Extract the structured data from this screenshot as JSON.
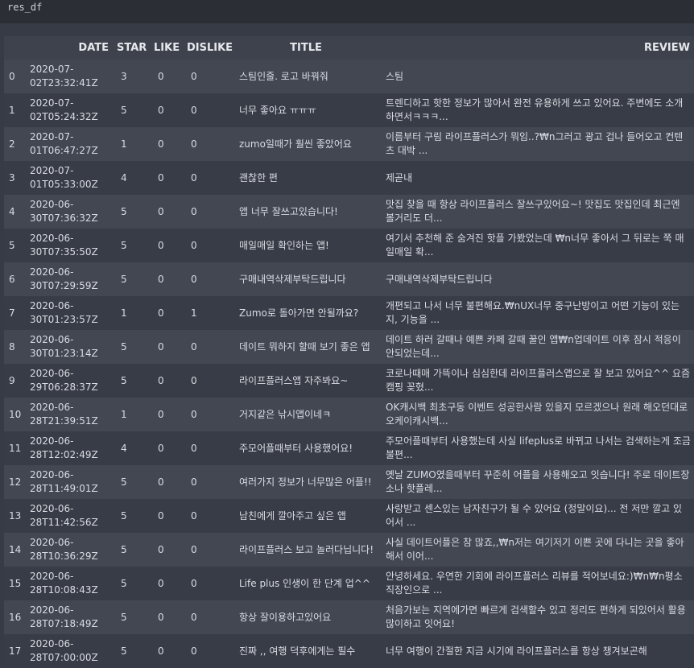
{
  "code": {
    "text": "res_df"
  },
  "table": {
    "columns": [
      "",
      "DATE",
      "STAR",
      "LIKE",
      "DISLIKE",
      "TITLE",
      "REVIEW"
    ],
    "rows": [
      {
        "idx": "0",
        "date": "2020-07-02T23:32:41Z",
        "star": "3",
        "like": "0",
        "dislike": "0",
        "title": "스팀인줄. 로고 바꿔줘",
        "review": "스팀"
      },
      {
        "idx": "1",
        "date": "2020-07-02T05:24:32Z",
        "star": "5",
        "like": "0",
        "dislike": "0",
        "title": "너무 좋아요 ㅠㅠㅠ",
        "review": "트렌디하고 핫한 정보가 많아서 완전 유용하게 쓰고 있어요. 주변에도 소개하면서ㅋㅋㅋ..."
      },
      {
        "idx": "2",
        "date": "2020-07-01T06:47:27Z",
        "star": "1",
        "like": "0",
        "dislike": "0",
        "title": "zumo일때가 훨씬 좋았어요",
        "review": "이름부터 구림 라이프플러스가 뭐임..?₩n그러고 광고 겁나 들어오고 컨텐츠 대박 ..."
      },
      {
        "idx": "3",
        "date": "2020-07-01T05:33:00Z",
        "star": "4",
        "like": "0",
        "dislike": "0",
        "title": "괜찮한 편",
        "review": "제곧내"
      },
      {
        "idx": "4",
        "date": "2020-06-30T07:36:32Z",
        "star": "5",
        "like": "0",
        "dislike": "0",
        "title": "앱 너무 잘쓰고있습니다!",
        "review": "맛집 찾을 때 항상 라이프플러스 잘쓰구있어요~! 맛집도 맛집인데 최근엔 볼거리도 더..."
      },
      {
        "idx": "5",
        "date": "2020-06-30T07:35:50Z",
        "star": "5",
        "like": "0",
        "dislike": "0",
        "title": "매일매일 확인하는 앱!",
        "review": "여기서 추천해 준 숨겨진 핫플 가봤었는데 ₩n너무 좋아서 그 뒤로는 쭉 매일매일 확..."
      },
      {
        "idx": "6",
        "date": "2020-06-30T07:29:59Z",
        "star": "5",
        "like": "0",
        "dislike": "0",
        "title": "구매내역삭제부탁드립니다",
        "review": "구매내역삭제부탁드립니다"
      },
      {
        "idx": "7",
        "date": "2020-06-30T01:23:57Z",
        "star": "1",
        "like": "0",
        "dislike": "1",
        "title": "Zumo로 돌아가면 안될까요?",
        "review": "개편되고 나서 너무 불편해요.₩nUX너무 중구난방이고 어떤 기능이 있는지, 기능을 ..."
      },
      {
        "idx": "8",
        "date": "2020-06-30T01:23:14Z",
        "star": "5",
        "like": "0",
        "dislike": "0",
        "title": "데이트 뭐하지 할때 보기 좋은 앱",
        "review": "데이트 하러 갈때나 예쁜 카페 갈때 꿀인 앱₩n업데이트 이후 잠시 적응이 안되었는데..."
      },
      {
        "idx": "9",
        "date": "2020-06-29T06:28:37Z",
        "star": "5",
        "like": "0",
        "dislike": "0",
        "title": "라이프플러스앱 자주봐요~",
        "review": "코로나때매 가뜩이나 심심한데 라이프플러스앱으로 잘 보고 있어요^^ 요즘 캠핑 꽂혔..."
      },
      {
        "idx": "10",
        "date": "2020-06-28T21:39:51Z",
        "star": "1",
        "like": "0",
        "dislike": "0",
        "title": "거지같은 낚시앱이네ㅋ",
        "review": "OK캐시백 최초구동 이벤트 성공한사람 있을지 모르겠으나 원래 해오던대로 오케이캐시백..."
      },
      {
        "idx": "11",
        "date": "2020-06-28T12:02:49Z",
        "star": "4",
        "like": "0",
        "dislike": "0",
        "title": "주모어플때부터 사용했어요!",
        "review": "주모어플때부터 사용했는데 사실 lifeplus로 바뀌고 나서는 검색하는게 조금 불편..."
      },
      {
        "idx": "12",
        "date": "2020-06-28T11:49:01Z",
        "star": "5",
        "like": "0",
        "dislike": "0",
        "title": "여러가지 정보가 너무많은 어플!!",
        "review": "옛날 ZUMO였을때부터 꾸준히 어플을 사용해오고 잇습니다! 주로 데이트장소나 핫플레..."
      },
      {
        "idx": "13",
        "date": "2020-06-28T11:42:56Z",
        "star": "5",
        "like": "0",
        "dislike": "0",
        "title": "남친에게 깔아주고 싶은 앱",
        "review": "사랑받고 센스있는 남자친구가 될 수 있어요 (정말이요)... 전 저만 깔고 있어서 ..."
      },
      {
        "idx": "14",
        "date": "2020-06-28T10:36:29Z",
        "star": "5",
        "like": "0",
        "dislike": "0",
        "title": "라이프플러스 보고 놀러다닙니다!",
        "review": "사실 데이트어플은 참 많죠,,₩n저는 여기저기 이쁜 곳에 다니는 곳을 좋아해서 이어..."
      },
      {
        "idx": "15",
        "date": "2020-06-28T10:08:43Z",
        "star": "5",
        "like": "0",
        "dislike": "0",
        "title": "Life plus 인생이 한 단계 업^^",
        "review": "안녕하세요. 우연한 기회에 라이프플러스 리뷰를 적어보네요:)₩n₩n평소 직장인으로 ..."
      },
      {
        "idx": "16",
        "date": "2020-06-28T07:18:49Z",
        "star": "5",
        "like": "0",
        "dislike": "0",
        "title": "항상 잘이용하고있어요",
        "review": "처음가보는 지역에가면 빠르게 검색할수 있고 정리도 편하게 되있어서 활용 많이하고 잇어요!"
      },
      {
        "idx": "17",
        "date": "2020-06-28T07:00:00Z",
        "star": "5",
        "like": "0",
        "dislike": "0",
        "title": "진짜 ,, 여행 덕후에게는 필수",
        "review": "너무 여행이 간절한 지금 시기에 라이프플러스를 항상 챙겨보곤해"
      }
    ]
  }
}
